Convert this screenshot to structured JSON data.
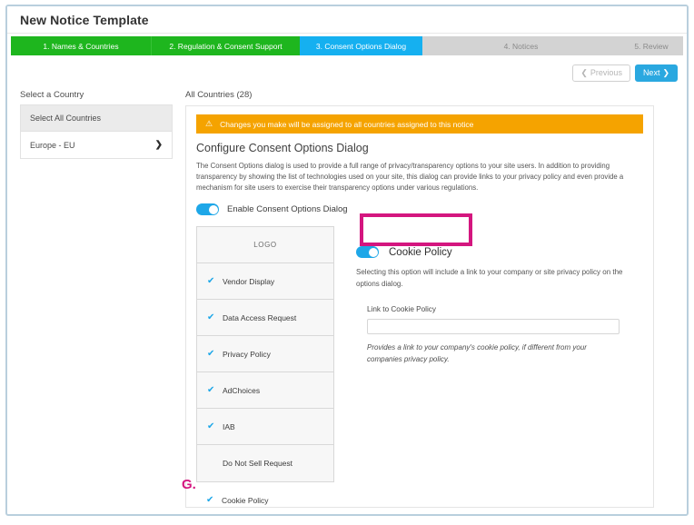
{
  "window": {
    "title": "New Notice Template"
  },
  "steps": [
    {
      "label": "1. Names & Countries",
      "state": "done"
    },
    {
      "label": "2. Regulation & Consent Support",
      "state": "done"
    },
    {
      "label": "3. Consent Options Dialog",
      "state": "current"
    },
    {
      "label": "4. Notices",
      "state": "todo"
    },
    {
      "label": "5. Review",
      "state": "todo"
    }
  ],
  "nav": {
    "previous_label": "Previous",
    "previous_icon": "chevron-left-icon",
    "next_label": "Next",
    "next_icon": "chevron-right-icon"
  },
  "left": {
    "label": "Select a Country",
    "items": [
      {
        "label": "Select All Countries",
        "selected": true,
        "chevron": ""
      },
      {
        "label": "Europe - EU",
        "selected": false,
        "chevron": "❯"
      }
    ]
  },
  "main": {
    "all_countries_label": "All Countries (28)",
    "warning": {
      "icon": "warning-triangle-icon",
      "text": "Changes you make will be assigned to all countries assigned to this notice"
    },
    "section_title": "Configure Consent Options Dialog",
    "section_desc": "The Consent Options dialog is used to provide a full range of privacy/transparency options to your site users. In addition to providing transparency by showing the list of technologies used on your site, this dialog can provide links to your privacy policy and even provide a mechanism for site users to exercise their transparency options under various regulations.",
    "enable_toggle": {
      "label": "Enable Consent Options Dialog",
      "on": true
    },
    "options": [
      {
        "label": "LOGO",
        "checked": false,
        "is_logo": true
      },
      {
        "label": "Vendor Display",
        "checked": true,
        "is_logo": false
      },
      {
        "label": "Data Access Request",
        "checked": true,
        "is_logo": false
      },
      {
        "label": "Privacy Policy",
        "checked": true,
        "is_logo": false
      },
      {
        "label": "AdChoices",
        "checked": true,
        "is_logo": false
      },
      {
        "label": "IAB",
        "checked": true,
        "is_logo": false
      },
      {
        "label": "Do Not Sell Request",
        "checked": false,
        "is_logo": false
      }
    ],
    "options_outside": {
      "label": "Cookie Policy",
      "checked": true
    },
    "detail": {
      "toggle_on": true,
      "title": "Cookie Policy",
      "description": "Selecting this option will include a link to your company or site privacy policy on the options dialog.",
      "field_label": "Link to Cookie Policy",
      "field_value": "",
      "field_placeholder": "",
      "field_help": "Provides a link to your company's cookie policy, if different from your companies privacy policy."
    }
  },
  "annotation": {
    "label": "G."
  },
  "colors": {
    "step_done": "#1eb61e",
    "step_current": "#15b0f0",
    "step_todo": "#d3d3d3",
    "warning_bg": "#f5a300",
    "toggle_on": "#1ea7e8",
    "accent_next": "#2aa8e0",
    "highlight": "#d4167f",
    "check": "#1ea7e8"
  },
  "icons": {
    "check": "✔",
    "warning": "⚠",
    "chevron_left": "❮",
    "chevron_right": "❯"
  }
}
